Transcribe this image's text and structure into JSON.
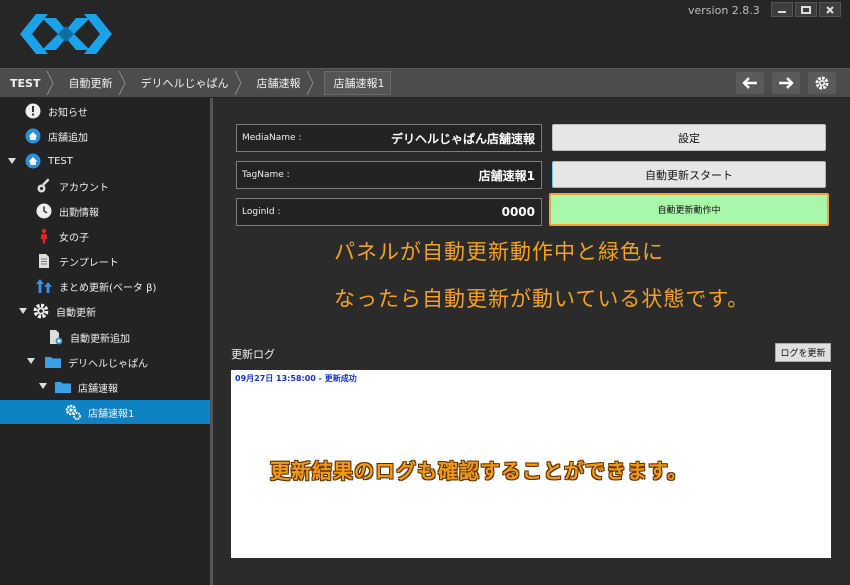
{
  "app": {
    "version": "version 2.8.3"
  },
  "breadcrumb": [
    "TEST",
    "自動更新",
    "デリヘルじゃぱん",
    "店舗速報",
    "店舗速報1"
  ],
  "sidebar": {
    "items": [
      {
        "label": "お知らせ",
        "icon": "info-icon"
      },
      {
        "label": "店舗追加",
        "icon": "home-add-icon"
      },
      {
        "label": "TEST",
        "icon": "home-icon"
      },
      {
        "label": "アカウント",
        "icon": "key-icon"
      },
      {
        "label": "出勤情報",
        "icon": "clock-icon"
      },
      {
        "label": "女の子",
        "icon": "person-icon"
      },
      {
        "label": "テンプレート",
        "icon": "document-icon"
      },
      {
        "label": "まとめ更新(ベータ β)",
        "icon": "upload-icon"
      },
      {
        "label": "自動更新",
        "icon": "gear-icon"
      },
      {
        "label": "自動更新追加",
        "icon": "document-add-icon"
      },
      {
        "label": "デリヘルじゃぱん",
        "icon": "folder-icon"
      },
      {
        "label": "店舗速報",
        "icon": "folder-icon"
      },
      {
        "label": "店舗速報1",
        "icon": "gears-icon"
      }
    ]
  },
  "form": {
    "media_label": "MediaName :",
    "media_value": "デリヘルじゃぱん店舗速報",
    "tag_label": "TagName :",
    "tag_value": "店舗速報1",
    "login_label": "LoginId :",
    "login_value": "0000"
  },
  "buttons": {
    "settings": "設定",
    "auto_start": "自動更新スタート",
    "running": "自動更新動作中"
  },
  "annotations": {
    "line1": "パネルが自動更新動作中と緑色に",
    "line2": "なったら自動更新が動いている状態です。",
    "line3": "更新結果のログも確認することができます。"
  },
  "log": {
    "label": "更新ログ",
    "refresh_button": "ログを更新",
    "entries": [
      "09月27日 13:58:00 - 更新成功"
    ]
  },
  "colors": {
    "accent": "#0f82c4",
    "running_bg": "#a9f7a9",
    "highlight_orange": "#f0a23c",
    "log_text": "#1530d6"
  }
}
